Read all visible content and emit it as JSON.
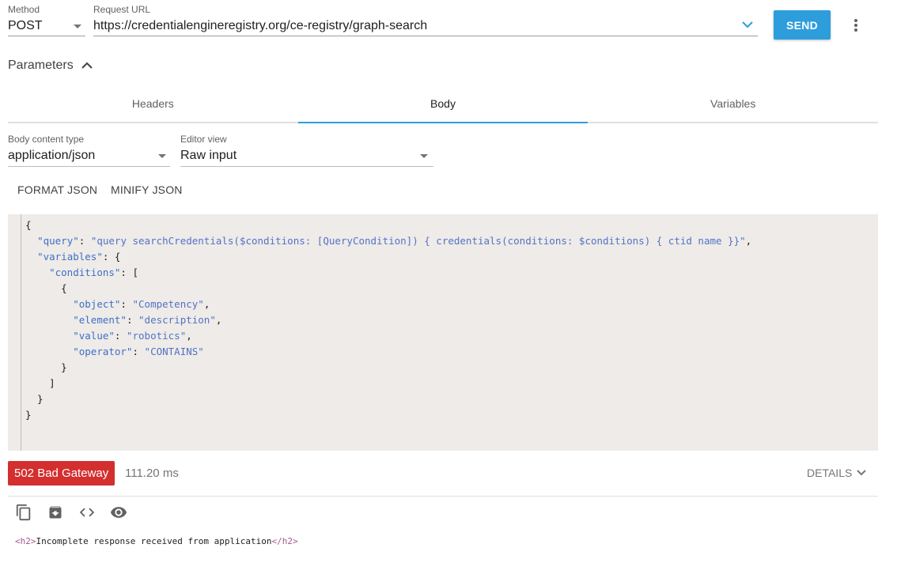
{
  "request": {
    "method_label": "Method",
    "method_value": "POST",
    "url_label": "Request URL",
    "url_value": "https://credentialengineregistry.org/ce-registry/graph-search",
    "send_label": "SEND"
  },
  "parameters": {
    "label": "Parameters"
  },
  "tabs": [
    {
      "label": "Headers",
      "active": false
    },
    {
      "label": "Body",
      "active": true
    },
    {
      "label": "Variables",
      "active": false
    }
  ],
  "body_options": {
    "content_type_label": "Body content type",
    "content_type_value": "application/json",
    "editor_view_label": "Editor view",
    "editor_view_value": "Raw input",
    "format_json": "FORMAT JSON",
    "minify_json": "MINIFY JSON"
  },
  "editor": {
    "query_value": "query searchCredentials($conditions: [QueryCondition]) { credentials(conditions: $conditions) { ctid name }}",
    "conditions": {
      "object": "Competency",
      "element": "description",
      "value": "robotics",
      "operator": "CONTAINS"
    }
  },
  "response": {
    "status": "502 Bad Gateway",
    "timing": "111.20 ms",
    "details_label": "DETAILS",
    "body_tag_open": "<h2>",
    "body_text": "Incomplete response received from application",
    "body_tag_close": "</h2>"
  },
  "icons": [
    "chevron-down-icon",
    "chevron-up-icon",
    "more-vert-icon",
    "copy-icon",
    "save-icon",
    "code-icon",
    "eye-icon"
  ],
  "colors": {
    "accent": "#2d9ddc",
    "error": "#d32f2f",
    "editor_bg": "#eeebe8",
    "json_key": "#3f6fc5"
  }
}
